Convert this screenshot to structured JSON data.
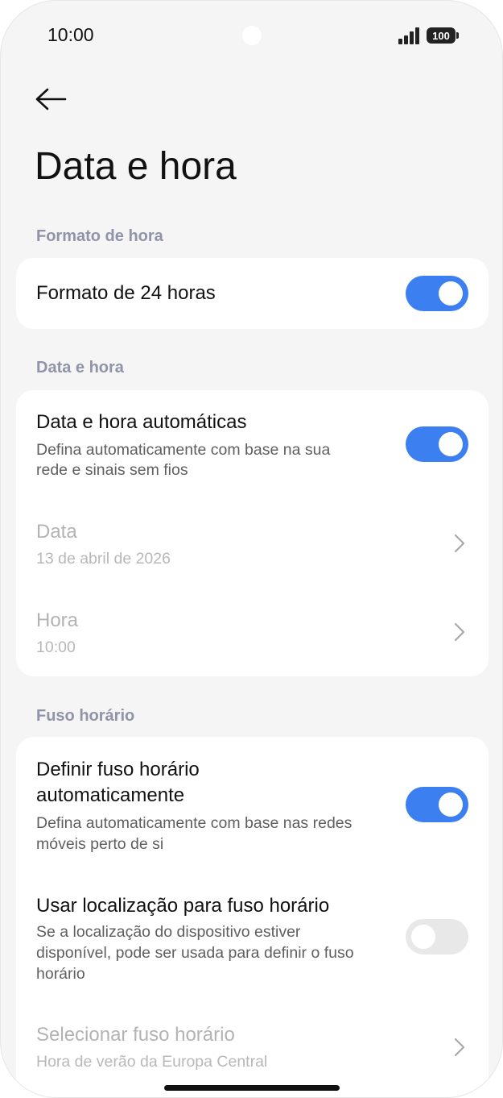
{
  "status_bar": {
    "time": "10:00",
    "battery": "100",
    "icons": [
      "signal-icon",
      "battery-icon",
      "camera-cutout"
    ]
  },
  "header": {
    "back_icon": "arrow-left-icon",
    "title": "Data e hora"
  },
  "sections": {
    "time_format": {
      "label": "Formato de hora",
      "rows": {
        "format_24h": {
          "title": "Formato de 24 horas",
          "toggle": "on"
        }
      }
    },
    "date_time": {
      "label": "Data e hora",
      "rows": {
        "auto": {
          "title": "Data e hora automáticas",
          "subtitle_line1": "Defina automaticamente com base na sua",
          "subtitle_line2": "rede e sinais sem fios",
          "toggle": "on"
        },
        "date": {
          "title": "Data",
          "value": "13 de abril de 2026",
          "enabled": false
        },
        "time": {
          "title": "Hora",
          "value": "10:00",
          "enabled": false
        }
      }
    },
    "timezone": {
      "label": "Fuso horário",
      "rows": {
        "auto_tz": {
          "title_line1": "Definir fuso horário",
          "title_line2": "automaticamente",
          "subtitle_line1": "Defina automaticamente com base nas redes",
          "subtitle_line2": "móveis perto de si",
          "toggle": "on"
        },
        "location_tz": {
          "title": "Usar localização para fuso horário",
          "subtitle_line1": "Se a localização do dispositivo estiver",
          "subtitle_line2": "disponível, pode ser usada para definir o fuso",
          "subtitle_line3": "horário",
          "toggle": "off"
        },
        "select_tz": {
          "title": "Selecionar fuso horário",
          "value": "Hora de verão da Europa Central",
          "enabled": false
        }
      }
    }
  },
  "colors": {
    "accent": "#3b7ff0",
    "section_label": "#8f94a8",
    "background": "#f5f5f5",
    "card": "#ffffff"
  }
}
